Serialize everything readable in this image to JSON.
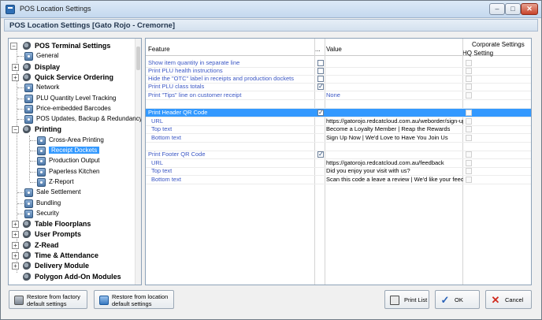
{
  "window": {
    "title": "POS Location Settings",
    "header": "POS Location Settings  [Gato Rojo - Cremorne]",
    "controls": [
      "–",
      "□",
      "✕"
    ]
  },
  "tree": [
    {
      "label": "POS Terminal Settings",
      "bold": true,
      "icon": "gears-icon",
      "expander": "−"
    },
    {
      "label": "General",
      "icon": "gear-icon"
    },
    {
      "label": "Display",
      "bold": true,
      "icon": "gears-icon",
      "expander": "+"
    },
    {
      "label": "Quick Service Ordering",
      "bold": true,
      "icon": "gears-icon",
      "expander": "+"
    },
    {
      "label": "Network",
      "icon": "gear-icon"
    },
    {
      "label": "PLU Quantity Level Tracking",
      "icon": "gear-icon"
    },
    {
      "label": "Price-embedded Barcodes",
      "icon": "gear-icon"
    },
    {
      "label": "POS Updates, Backup & Redundancy",
      "icon": "gear-icon"
    },
    {
      "label": "Printing",
      "bold": true,
      "icon": "gears-icon",
      "expander": "−"
    },
    {
      "label": "Cross-Area Printing",
      "icon": "gear-icon"
    },
    {
      "label": "Receipt Dockets",
      "icon": "gear-icon",
      "selected": true
    },
    {
      "label": "Production Output",
      "icon": "gear-icon"
    },
    {
      "label": "Paperless Kitchen",
      "icon": "gear-icon"
    },
    {
      "label": "Z-Report",
      "icon": "gear-icon"
    },
    {
      "label": "Sale Settlement",
      "icon": "gear-icon"
    },
    {
      "label": "Bundling",
      "icon": "gear-icon"
    },
    {
      "label": "Security",
      "icon": "gear-icon"
    },
    {
      "label": "Table Floorplans",
      "bold": true,
      "icon": "gears-icon",
      "expander": "+"
    },
    {
      "label": "User Prompts",
      "bold": true,
      "icon": "gears-icon",
      "expander": "+"
    },
    {
      "label": "Z-Read",
      "bold": true,
      "icon": "gears-icon",
      "expander": "+"
    },
    {
      "label": "Time & Attendance",
      "bold": true,
      "icon": "gears-icon",
      "expander": "+"
    },
    {
      "label": "Delivery Module",
      "bold": true,
      "icon": "gears-icon",
      "expander": "+"
    },
    {
      "label": "Polygon Add-On Modules",
      "bold": true,
      "icon": "gears-icon"
    }
  ],
  "grid": {
    "headers": {
      "feature": "Feature",
      "dots": "...",
      "value": "Value",
      "corporate": "Corporate Settings",
      "hq": "HQ Setting"
    },
    "rows": [
      {
        "feature": "Show item quantity in separate line",
        "checkbox": "",
        "value": ""
      },
      {
        "feature": "Print PLU health instructions",
        "checkbox": "",
        "value": ""
      },
      {
        "feature": "Hide the \"OTC\" label in receipts and production dockets",
        "checkbox": "",
        "value": ""
      },
      {
        "feature": "Print PLU class totals",
        "checkbox": "✓",
        "value": ""
      },
      {
        "feature": "Print \"Tips\" line on customer receipt",
        "value": "None",
        "value_blue": true
      },
      {
        "feature": "",
        "value": ""
      },
      {
        "feature": "Print Header QR Code",
        "checkbox": "✓",
        "value": "",
        "selected": true
      },
      {
        "feature": "URL",
        "child": true,
        "value": "https://gatorojo.redcatcloud.com.au/weborder/sign-up"
      },
      {
        "feature": "Top text",
        "child": true,
        "value": "Become a Loyalty Member | Reap the Rewards"
      },
      {
        "feature": "Bottom text",
        "child": true,
        "value": "Sign Up Now | We'd Love to Have You Join Us"
      },
      {
        "feature": "",
        "value": ""
      },
      {
        "feature": "Print Footer QR Code",
        "checkbox": "✓",
        "value": ""
      },
      {
        "feature": "URL",
        "child": true,
        "value": "https://gatorojo.redcatcloud.com.au/feedback"
      },
      {
        "feature": "Top text",
        "child": true,
        "value": "Did you enjoy your visit with us?"
      },
      {
        "feature": "Bottom text",
        "child": true,
        "value": "Scan this code a leave a review | We'd like your feedback"
      }
    ]
  },
  "buttons": {
    "restore_factory": [
      "Restore from factory",
      "default settings"
    ],
    "restore_location": [
      "Restore from location",
      "default settings"
    ],
    "print_list": "Print List",
    "ok": "OK",
    "cancel": "Cancel"
  }
}
